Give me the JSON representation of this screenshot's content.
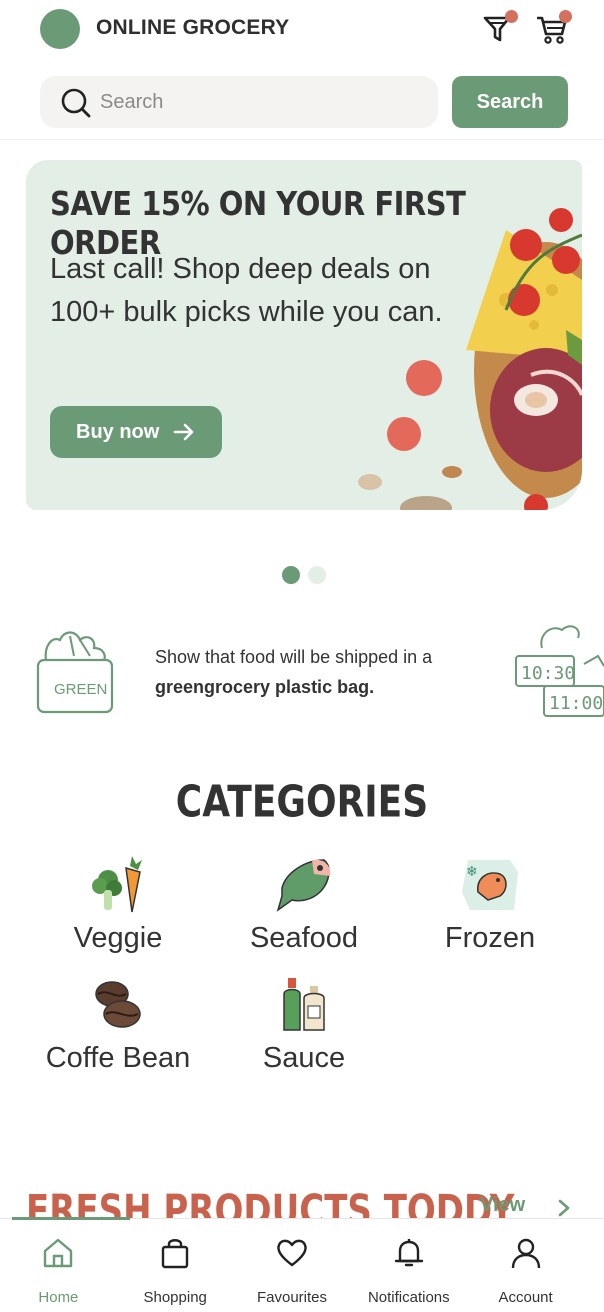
{
  "colors": {
    "accent": "#6a9a76",
    "accent_light": "#e3efe6",
    "promo": "#c9624d",
    "badge": "#d4705e"
  },
  "header": {
    "brand": "ONLINE GROCERY"
  },
  "search": {
    "placeholder": "Search",
    "value": "",
    "button_label": "Search"
  },
  "banner": {
    "title": "SAVE 15% ON YOUR FIRST ORDER",
    "text": "Last call! Shop deep deals on 100+ bulk picks while you can.",
    "button_label": "Buy now"
  },
  "carousel": {
    "pages": 2,
    "active": 1
  },
  "info": {
    "text_before": "Show that food will be shipped in a",
    "text_bold": "greengrocery plastic bag.",
    "bag_label": "GREEN",
    "clock_top": "10:30",
    "clock_bottom": "11:00"
  },
  "categories": {
    "title": "CATEGORIES",
    "items": [
      {
        "label": "Veggie",
        "icon": "veggie-icon"
      },
      {
        "label": "Seafood",
        "icon": "fish-icon"
      },
      {
        "label": "Frozen",
        "icon": "frozen-shrimp-icon"
      },
      {
        "label": "Coffe Bean",
        "icon": "coffee-bean-icon"
      },
      {
        "label": "Sauce",
        "icon": "sauce-bottles-icon"
      }
    ]
  },
  "fresh": {
    "title": "FRESH PRODUCTS TODDY",
    "view_label": "View"
  },
  "nav": {
    "items": [
      {
        "label": "Home",
        "icon": "home-icon",
        "active": true
      },
      {
        "label": "Shopping",
        "icon": "shopping-bag-icon",
        "active": false
      },
      {
        "label": "Favourites",
        "icon": "heart-icon",
        "active": false
      },
      {
        "label": "Notifications",
        "icon": "bell-icon",
        "active": false
      },
      {
        "label": "Account",
        "icon": "user-icon",
        "active": false
      }
    ]
  }
}
